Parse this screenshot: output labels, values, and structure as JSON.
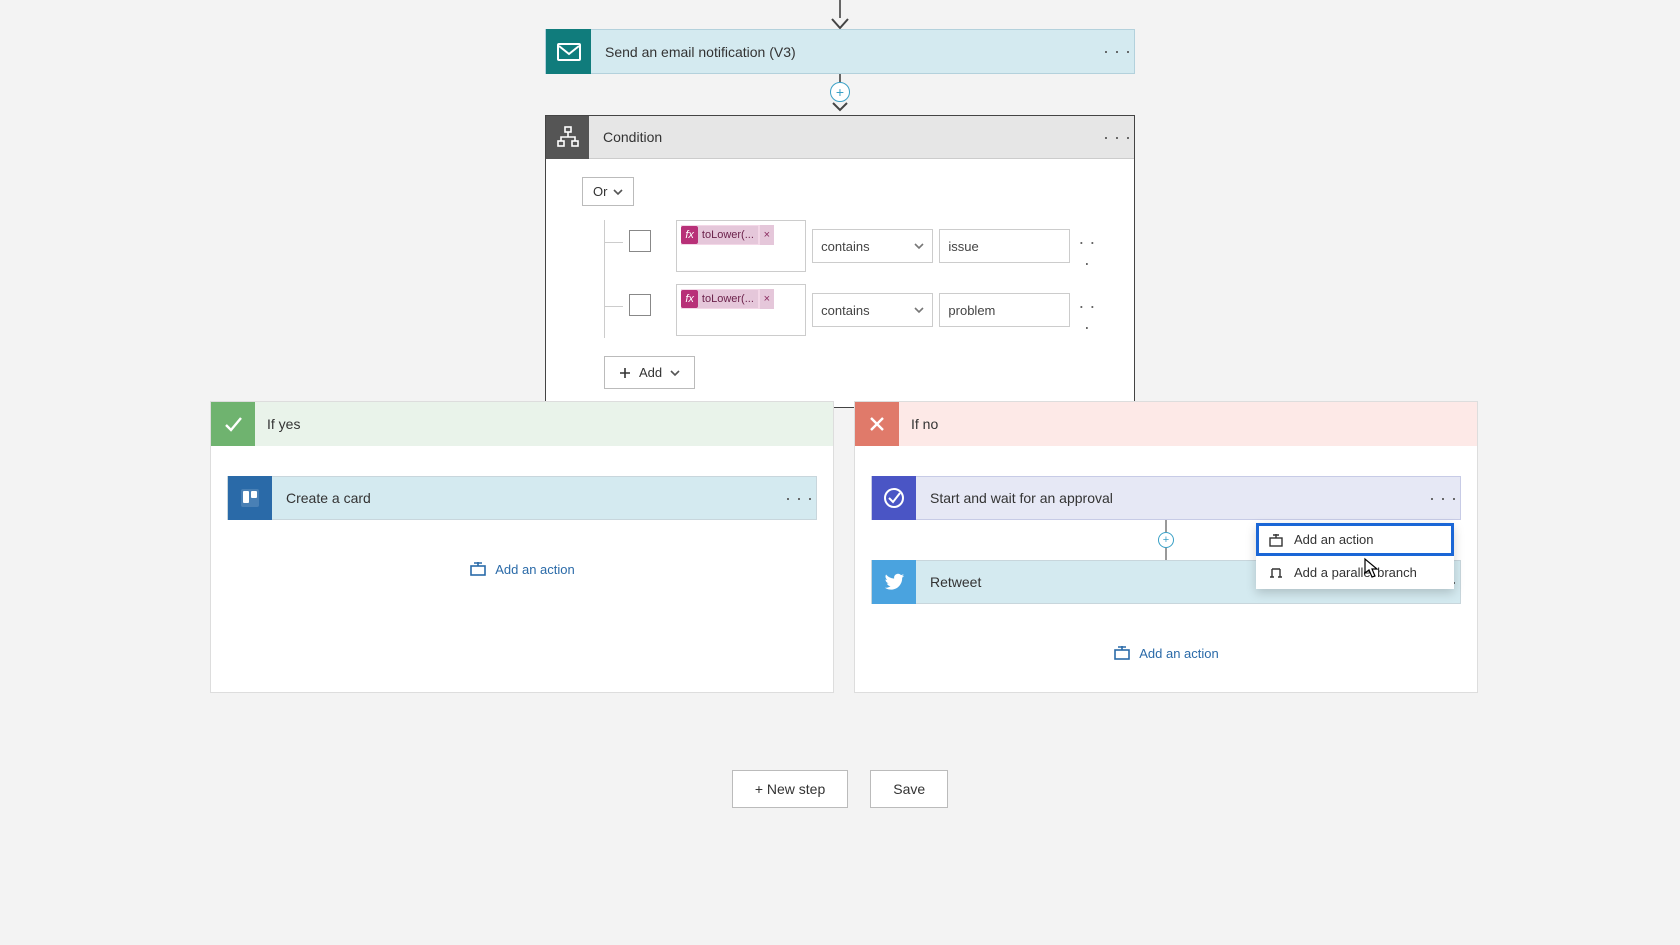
{
  "incoming_arrow": true,
  "email_step": {
    "title": "Send an email notification (V3)"
  },
  "condition": {
    "title": "Condition",
    "group_operator": "Or",
    "rows": [
      {
        "expr_label": "toLower(...",
        "operator": "contains",
        "value": "issue"
      },
      {
        "expr_label": "toLower(...",
        "operator": "contains",
        "value": "problem"
      }
    ],
    "add_label": "Add"
  },
  "branches": {
    "yes": {
      "title": "If yes",
      "actions": [
        {
          "kind": "trello",
          "title": "Create a card"
        }
      ],
      "add_action_label": "Add an action"
    },
    "no": {
      "title": "If no",
      "actions": [
        {
          "kind": "approval",
          "title": "Start and wait for an approval"
        },
        {
          "kind": "twitter",
          "title": "Retweet"
        }
      ],
      "add_action_label": "Add an action"
    }
  },
  "insert_menu": {
    "option_action": "Add an action",
    "option_parallel": "Add a parallel branch"
  },
  "footer": {
    "new_step": "+ New step",
    "save": "Save"
  }
}
